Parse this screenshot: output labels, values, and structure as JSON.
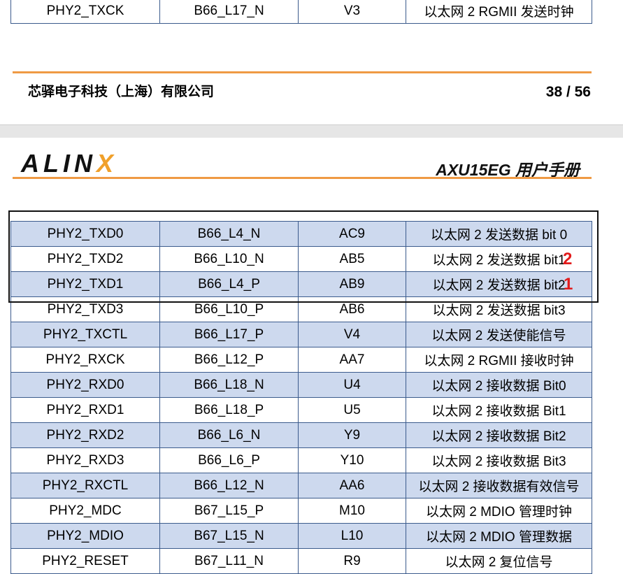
{
  "top_table": {
    "rows": [
      [
        "PHY2_TXCK",
        "B66_L17_N",
        "V3",
        "以太网 2 RGMII  发送时钟"
      ]
    ]
  },
  "footer": {
    "company": "芯驿电子科技（上海）有限公司",
    "page": "38 / 56"
  },
  "header": {
    "logo_main": "ALIN",
    "logo_accent": "X",
    "manual_title": "AXU15EG 用户手册"
  },
  "main_table": {
    "rows": [
      [
        "PHY2_TXD0",
        "B66_L4_N",
        "AC9",
        "以太网 2 发送数据 bit 0"
      ],
      [
        "PHY2_TXD2",
        "B66_L10_N",
        "AB5",
        "以太网 2 发送数据 bit1"
      ],
      [
        "PHY2_TXD1",
        "B66_L4_P",
        "AB9",
        "以太网 2 发送数据 bit2"
      ],
      [
        "PHY2_TXD3",
        "B66_L10_P",
        "AB6",
        "以太网 2 发送数据 bit3"
      ],
      [
        "PHY2_TXCTL",
        "B66_L17_P",
        "V4",
        "以太网 2 发送使能信号"
      ],
      [
        "PHY2_RXCK",
        "B66_L12_P",
        "AA7",
        "以太网 2 RGMII 接收时钟"
      ],
      [
        "PHY2_RXD0",
        "B66_L18_N",
        "U4",
        "以太网 2 接收数据 Bit0"
      ],
      [
        "PHY2_RXD1",
        "B66_L18_P",
        "U5",
        "以太网 2 接收数据 Bit1"
      ],
      [
        "PHY2_RXD2",
        "B66_L6_N",
        "Y9",
        "以太网 2 接收数据 Bit2"
      ],
      [
        "PHY2_RXD3",
        "B66_L6_P",
        "Y10",
        "以太网 2 接收数据 Bit3"
      ],
      [
        "PHY2_RXCTL",
        "B66_L12_N",
        "AA6",
        "以太网 2 接收数据有效信号"
      ],
      [
        "PHY2_MDC",
        "B67_L15_P",
        "M10",
        "以太网 2 MDIO 管理时钟"
      ],
      [
        "PHY2_MDIO",
        "B67_L15_N",
        "L10",
        "以太网 2 MDIO 管理数据"
      ],
      [
        "PHY2_RESET",
        "B67_L11_N",
        "R9",
        "以太网 2 复位信号"
      ]
    ]
  },
  "annotations": {
    "mark_1": "2",
    "mark_2": "1",
    "mark_color": "#e21b1b"
  },
  "colors": {
    "row_shade": "#cdd9ee",
    "accent_line": "#ef9a44",
    "table_border": "#3b5b8c"
  }
}
